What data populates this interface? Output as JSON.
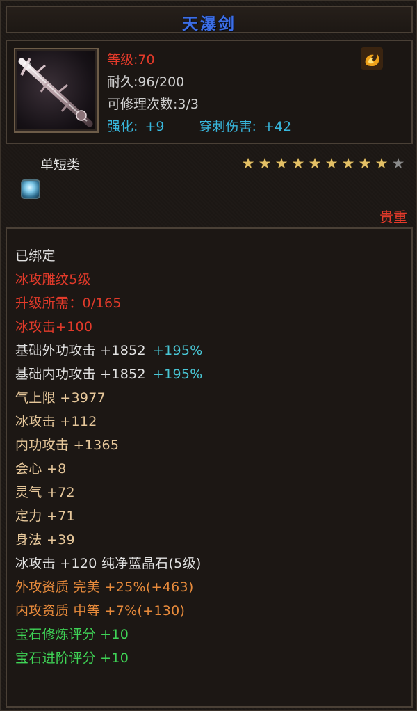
{
  "item": {
    "name": "天瀑剑",
    "level_text": "等级:70",
    "durability_text": "耐久:96/200",
    "repair_text": "可修理次数:3/3",
    "enhance_label": "强化:",
    "enhance_value": "+9",
    "pierce_label": "穿刺伤害:",
    "pierce_value": "+42",
    "category": "单短类",
    "stars_total": 10,
    "stars_filled": 9,
    "rarity": "贵重",
    "bind_icon": "flame-swirl-icon",
    "gem_icon": "blue-crystal-gem-icon"
  },
  "details": [
    {
      "parts": [
        {
          "text": "已绑定",
          "color": "white"
        }
      ]
    },
    {
      "parts": [
        {
          "text": "冰攻雕纹5级",
          "color": "red"
        }
      ]
    },
    {
      "parts": [
        {
          "text": "升级所需：0/165",
          "color": "red"
        }
      ]
    },
    {
      "parts": [
        {
          "text": "冰攻击+100",
          "color": "red"
        }
      ]
    },
    {
      "parts": [
        {
          "text": "基础外功攻击 +1852",
          "color": "white"
        },
        {
          "text": "+195%",
          "color": "teal"
        }
      ]
    },
    {
      "parts": [
        {
          "text": "基础内功攻击 +1852",
          "color": "white"
        },
        {
          "text": "+195%",
          "color": "teal"
        }
      ]
    },
    {
      "parts": [
        {
          "text": "气上限 +3977",
          "color": "gold"
        }
      ]
    },
    {
      "parts": [
        {
          "text": "冰攻击 +112",
          "color": "gold"
        }
      ]
    },
    {
      "parts": [
        {
          "text": "内功攻击 +1365",
          "color": "gold"
        }
      ]
    },
    {
      "parts": [
        {
          "text": "会心 +8",
          "color": "gold"
        }
      ]
    },
    {
      "parts": [
        {
          "text": "灵气 +72",
          "color": "gold"
        }
      ]
    },
    {
      "parts": [
        {
          "text": "定力 +71",
          "color": "gold"
        }
      ]
    },
    {
      "parts": [
        {
          "text": "身法 +39",
          "color": "gold"
        }
      ]
    },
    {
      "parts": [
        {
          "text": "冰攻击 +120 纯净蓝晶石(5级)",
          "color": "white"
        }
      ]
    },
    {
      "parts": [
        {
          "text": "外攻资质  完美 +25%(+463)",
          "color": "orange"
        }
      ]
    },
    {
      "parts": [
        {
          "text": "内攻资质  中等 +7%(+130)",
          "color": "orange"
        }
      ]
    },
    {
      "parts": [
        {
          "text": "宝石修炼评分 +10",
          "color": "green"
        }
      ]
    },
    {
      "parts": [
        {
          "text": "宝石进阶评分 +10",
          "color": "green"
        }
      ]
    }
  ],
  "colors": {
    "title": "#3c6ee6",
    "red": "#e23a2a",
    "teal": "#49c7d6",
    "cyan": "#38b7dd",
    "orange": "#e78a3b",
    "green": "#3fd456",
    "star": "#e3c066"
  }
}
